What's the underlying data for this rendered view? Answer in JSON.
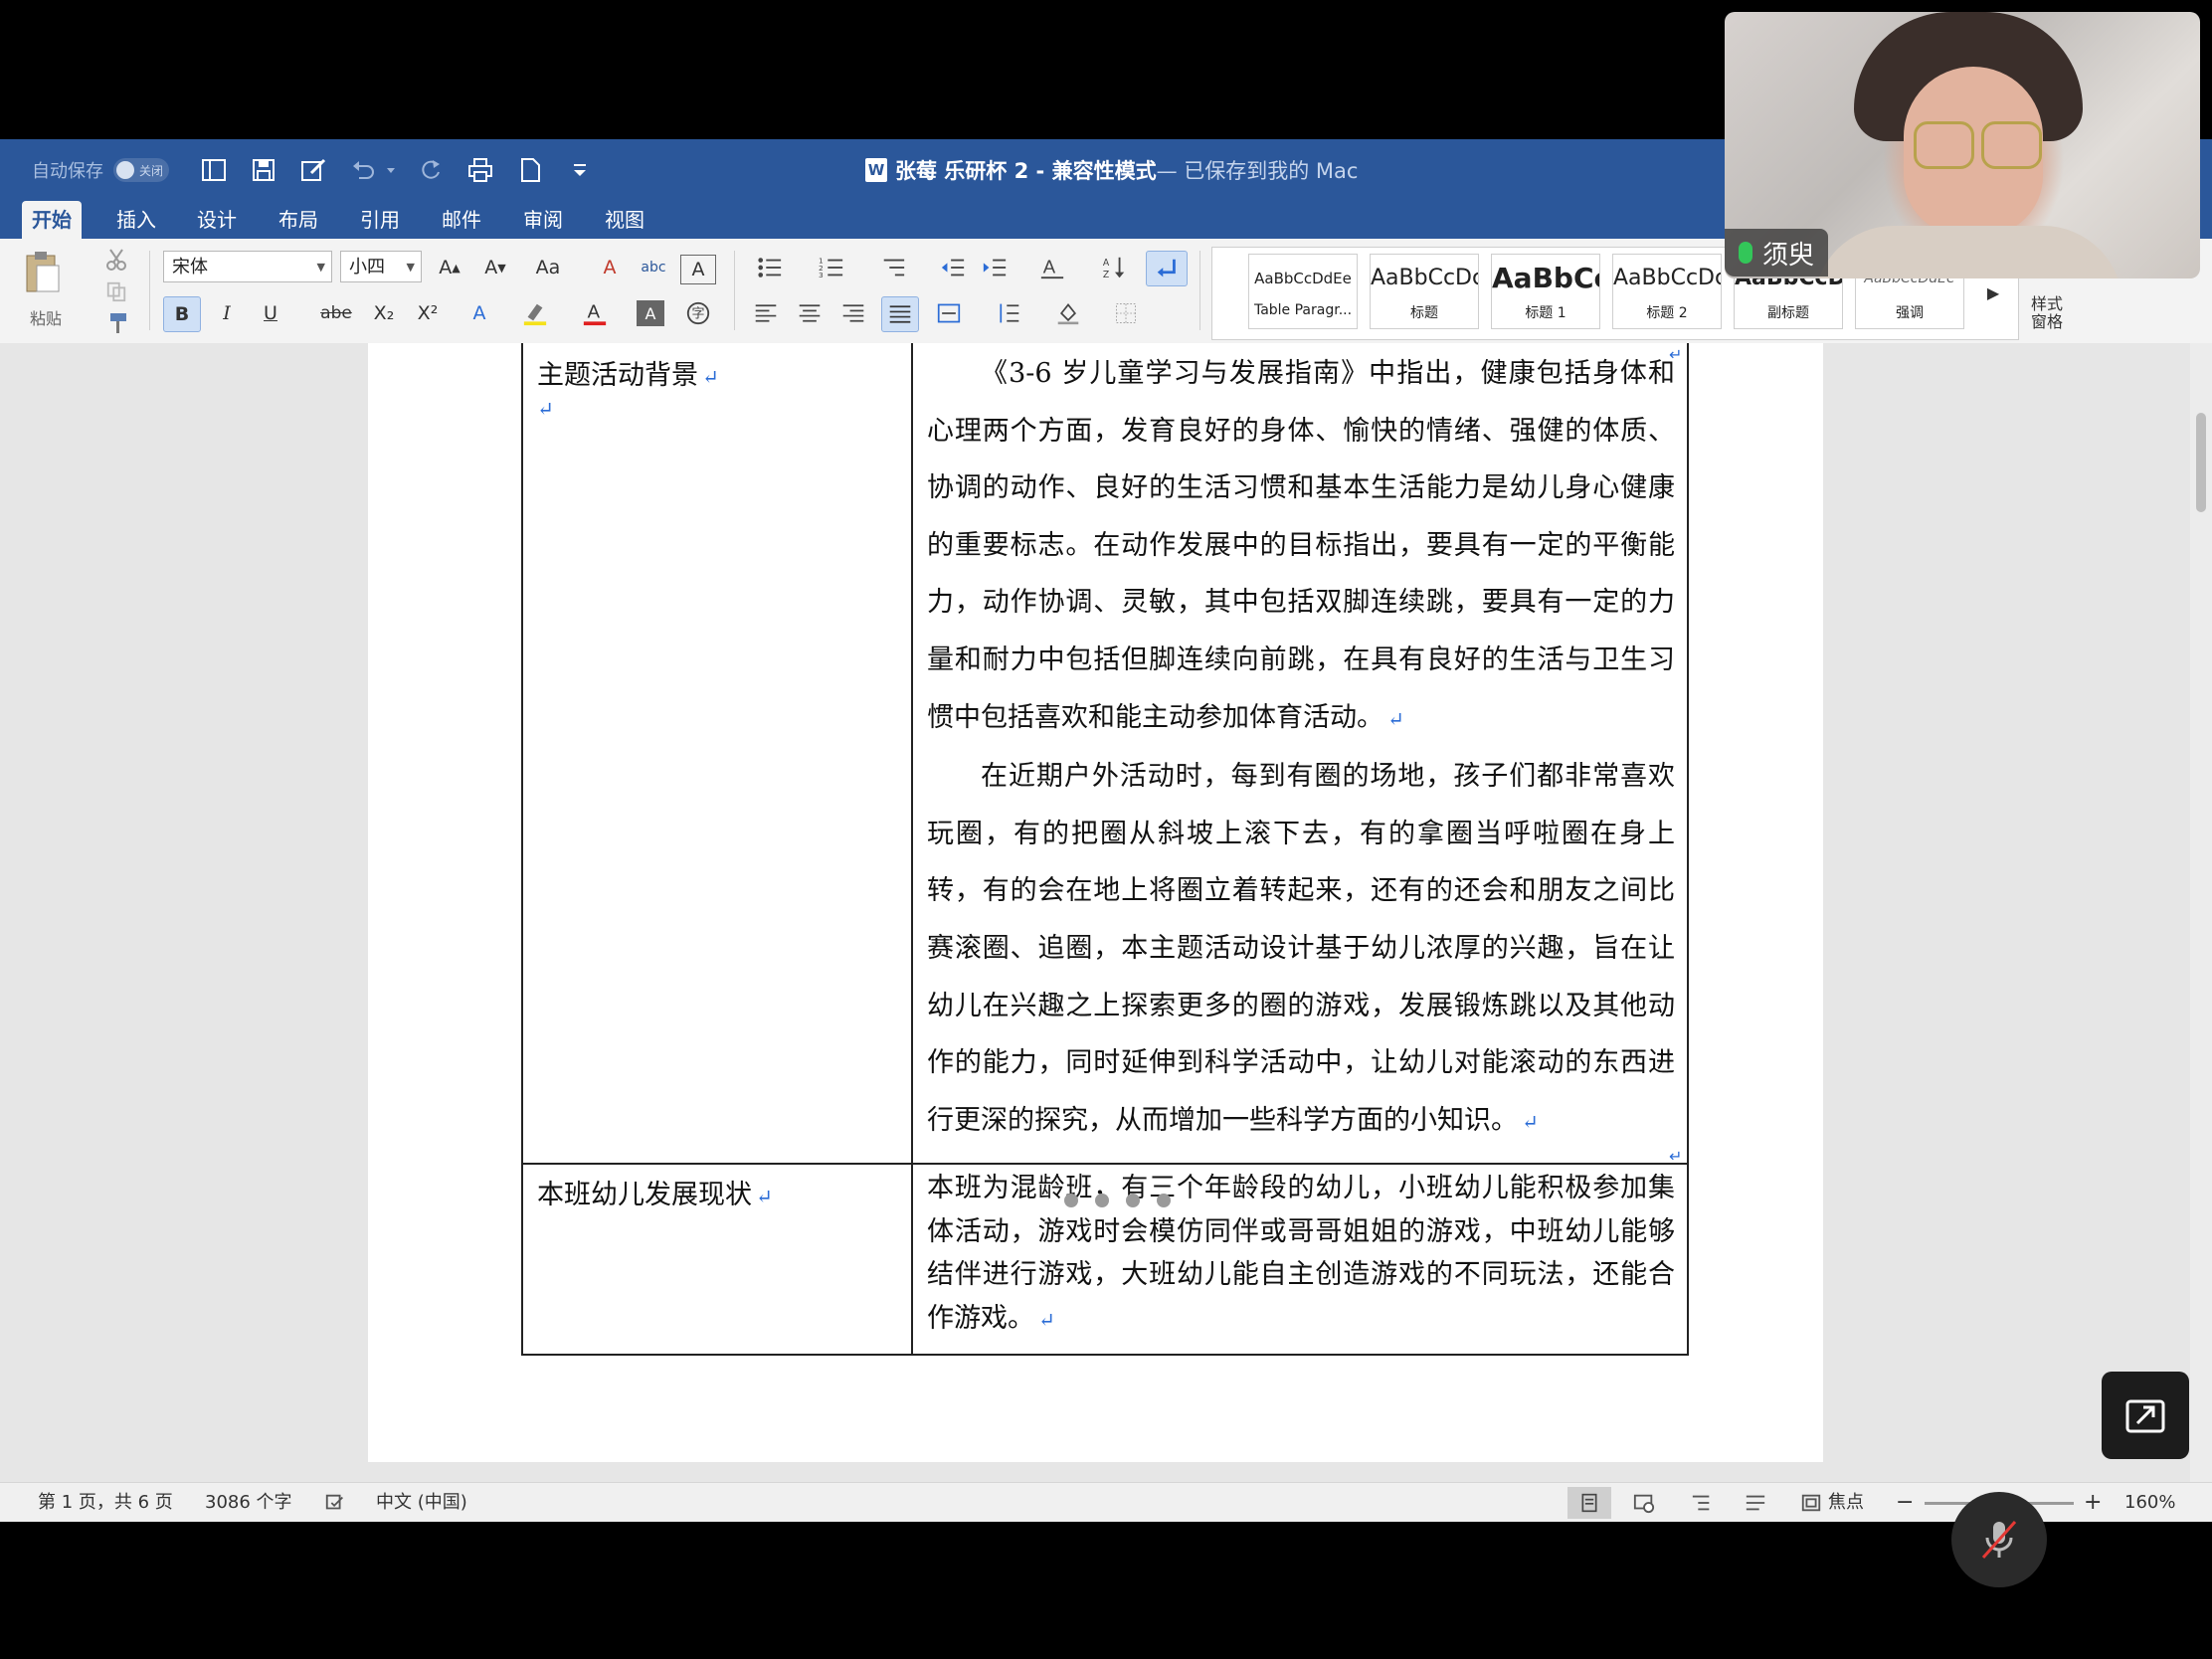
{
  "titlebar": {
    "autosave_label": "自动保存",
    "autosave_state": "关闭",
    "doc_icon": "W",
    "doc_name": "张莓 乐研杯 2 - 兼容性模式",
    "doc_status": " — 已保存到我的 Mac"
  },
  "tabs": [
    "开始",
    "插入",
    "设计",
    "布局",
    "引用",
    "邮件",
    "审阅",
    "视图"
  ],
  "ribbon": {
    "paste_label": "粘贴",
    "font_name": "宋体",
    "font_size": "小四",
    "bold": "B",
    "italic": "I",
    "underline": "U",
    "strike": "abe",
    "subscript": "X₂",
    "superscript": "X²",
    "styles": [
      {
        "preview": "AaBbCcDdEe",
        "name": "Table Paragr..."
      },
      {
        "preview": "AaBbCcDc",
        "name": "标题"
      },
      {
        "preview": "AaBbCc",
        "name": "标题 1"
      },
      {
        "preview": "AaBbCcDc",
        "name": "标题 2"
      },
      {
        "preview": "AaBbCcDc",
        "name": "副标题"
      },
      {
        "preview": "AaBbCcDdEe",
        "name": "强调"
      }
    ],
    "style_pane_label": "样式\n窗格"
  },
  "document": {
    "rows": [
      {
        "label": "主题活动背景",
        "paragraphs": [
          "《3-6 岁儿童学习与发展指南》中指出，健康包括身体和心理两个方面，发育良好的身体、愉快的情绪、强健的体质、协调的动作、良好的生活习惯和基本生活能力是幼儿身心健康的重要标志。在动作发展中的目标指出，要具有一定的平衡能力，动作协调、灵敏，其中包括双脚连续跳，要具有一定的力量和耐力中包括但脚连续向前跳，在具有良好的生活与卫生习惯中包括喜欢和能主动参加体育活动。",
          "在近期户外活动时，每到有圈的场地，孩子们都非常喜欢玩圈，有的把圈从斜坡上滚下去，有的拿圈当呼啦圈在身上转，有的会在地上将圈立着转起来，还有的还会和朋友之间比赛滚圈、追圈，本主题活动设计基于幼儿浓厚的兴趣，旨在让幼儿在兴趣之上探索更多的圈的游戏，发展锻炼跳以及其他动作的能力，同时延伸到科学活动中，让幼儿对能滚动的东西进行更深的探究，从而增加一些科学方面的小知识。"
        ]
      },
      {
        "label": "本班幼儿发展现状",
        "paragraphs": [
          "本班为混龄班，有三个年龄段的幼儿，小班幼儿能积极参加集体活动，游戏时会模仿同伴或哥哥姐姐的游戏，中班幼儿能够结伴进行游戏，大班幼儿能自主创造游戏的不同玩法，还能合作游戏。"
        ]
      }
    ],
    "return_mark": "↵"
  },
  "statusbar": {
    "page_info": "第 1 页，共 6 页",
    "word_count": "3086 个字",
    "language": "中文 (中国)",
    "focus_label": "焦点",
    "zoom": "160%"
  },
  "video": {
    "participant_name": "须臾"
  },
  "colors": {
    "word_blue": "#2b579a",
    "mic_green": "#33c659"
  }
}
